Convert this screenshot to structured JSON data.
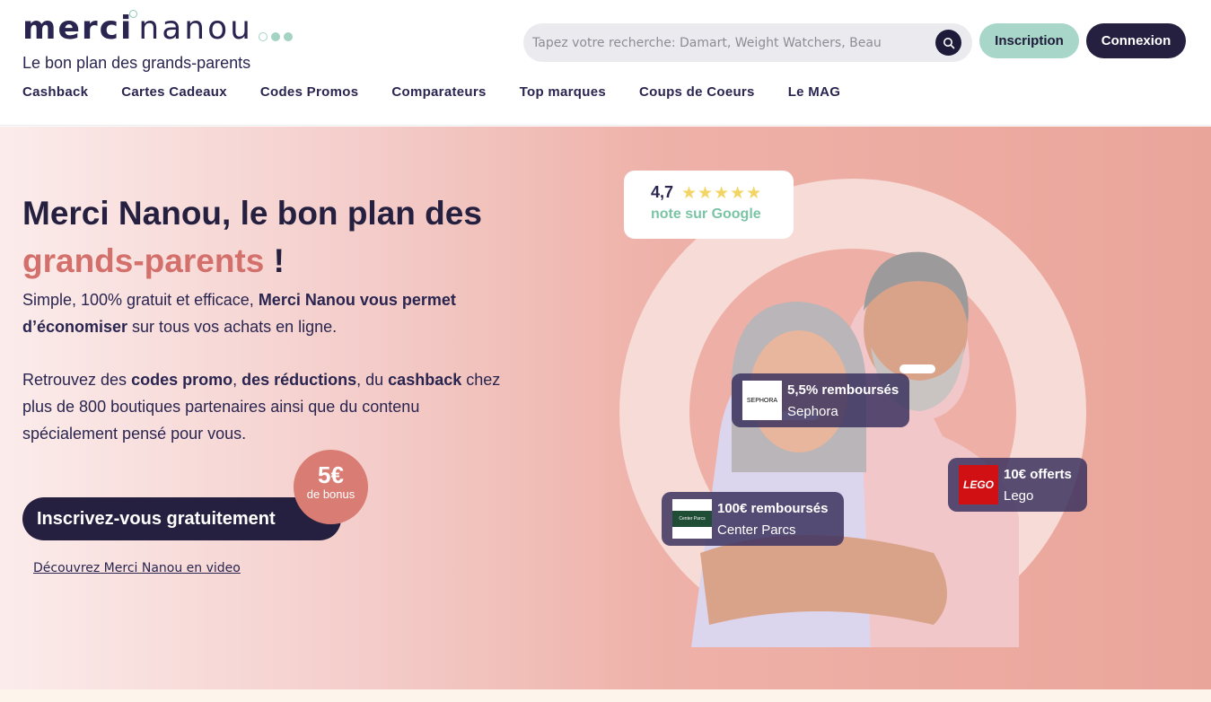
{
  "brand": {
    "logo_merci": "merci",
    "logo_nanou": "nanou",
    "tagline": "Le bon plan des grands-parents"
  },
  "nav": [
    "Cashback",
    "Cartes Cadeaux",
    "Codes Promos",
    "Comparateurs",
    "Top marques",
    "Coups de Coeurs",
    "Le MAG"
  ],
  "search": {
    "placeholder": "Tapez votre recherche: Damart, Weight Watchers, Beau"
  },
  "auth": {
    "signup": "Inscription",
    "login": "Connexion"
  },
  "hero": {
    "title_line1": "Merci Nanou, le bon plan des",
    "title_accent": "grands-parents",
    "title_end": " !",
    "p1_plain": "Simple, 100% gratuit et efficace, ",
    "p1_bold": "Merci Nanou vous permet d’économiser",
    "p1_end": " sur tous vos achats en ligne.",
    "p2_a": "Retrouvez des ",
    "p2_b": "codes promo",
    "p2_c": ", ",
    "p2_d": "des réductions",
    "p2_e": ", du ",
    "p2_f": "cashback",
    "p2_g": " chez plus de 800 boutiques partenaires ainsi que du contenu spécialement pensé pour vous.",
    "cta": "Inscrivez-vous gratuitement",
    "bonus_amount": "5€",
    "bonus_label": "de bonus",
    "video_link": "Découvrez Merci Nanou en video"
  },
  "rating": {
    "score": "4,7",
    "stars": 4.7,
    "label": "note sur Google"
  },
  "offers": {
    "sephora": {
      "amount": "5,5% remboursés",
      "brand": "Sephora",
      "logo_text": "SEPHORA"
    },
    "lego": {
      "amount": "10€ offerts",
      "brand": "Lego",
      "logo_text": "LEGO"
    },
    "center_parcs": {
      "amount": "100€ remboursés",
      "brand": "Center Parcs",
      "logo_text": "Center Parcs"
    }
  },
  "colors": {
    "navy": "#25203f",
    "mint": "#a8d6c8",
    "coral": "#d4706b",
    "hero_bg": "#eeb1a8"
  }
}
